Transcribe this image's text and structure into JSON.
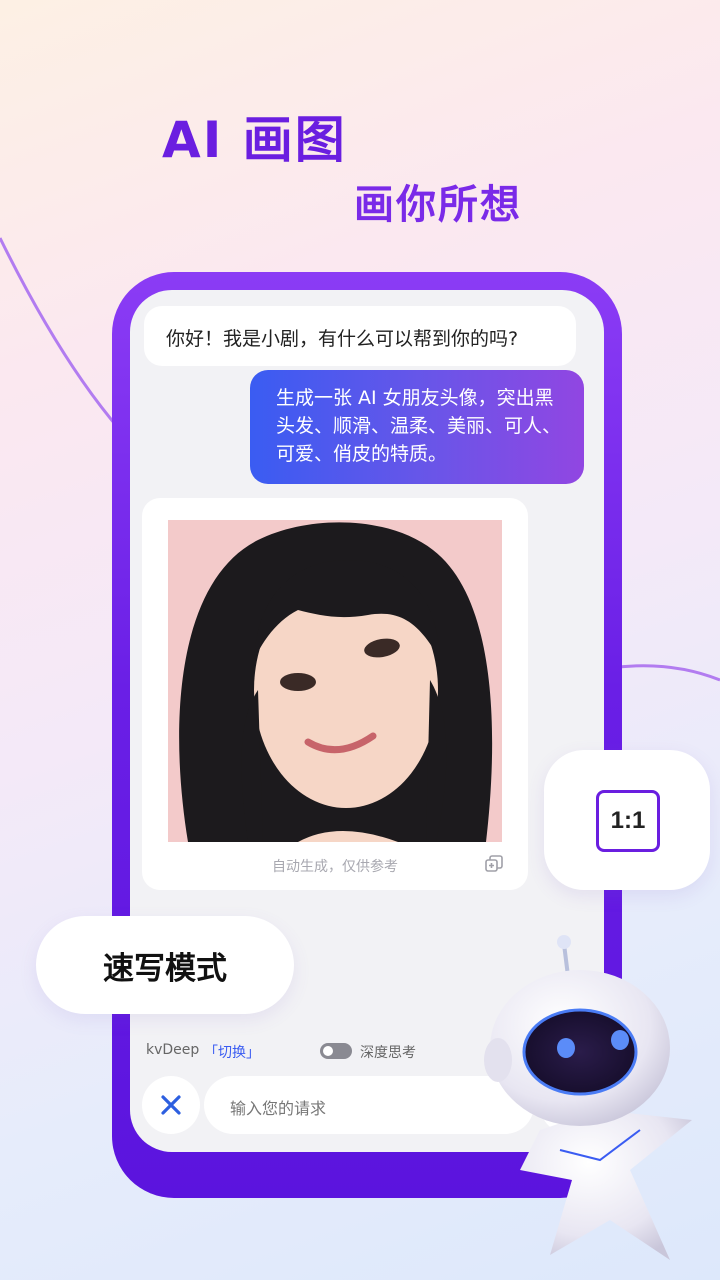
{
  "hero": {
    "title": "AI 画图",
    "subtitle": "画你所想"
  },
  "chat": {
    "bot_greeting": "你好！我是小剧，有什么可以帮到你的吗?",
    "user_prompt": "生成一张 AI 女朋友头像，突出黑头发、顺滑、温柔、美丽、可人、可爱、俏皮的特质。",
    "image_caption": "自动生成，仅供参考"
  },
  "composer": {
    "model_name": "kvDeep",
    "switch_label": "「切换」",
    "deep_think_label": "深度思考",
    "deep_think_on": false,
    "input_placeholder": "输入您的请求"
  },
  "badges": {
    "aspect_ratio": "1:1",
    "mode": "速写模式"
  },
  "icons": [
    "copy-icon",
    "close-icon",
    "toggle-switch",
    "robot-mascot"
  ],
  "colors": {
    "brand_purple": "#6a1ee0",
    "user_bubble_start": "#3a5cf2",
    "user_bubble_end": "#9146e2",
    "link_blue": "#3a5cf2"
  }
}
